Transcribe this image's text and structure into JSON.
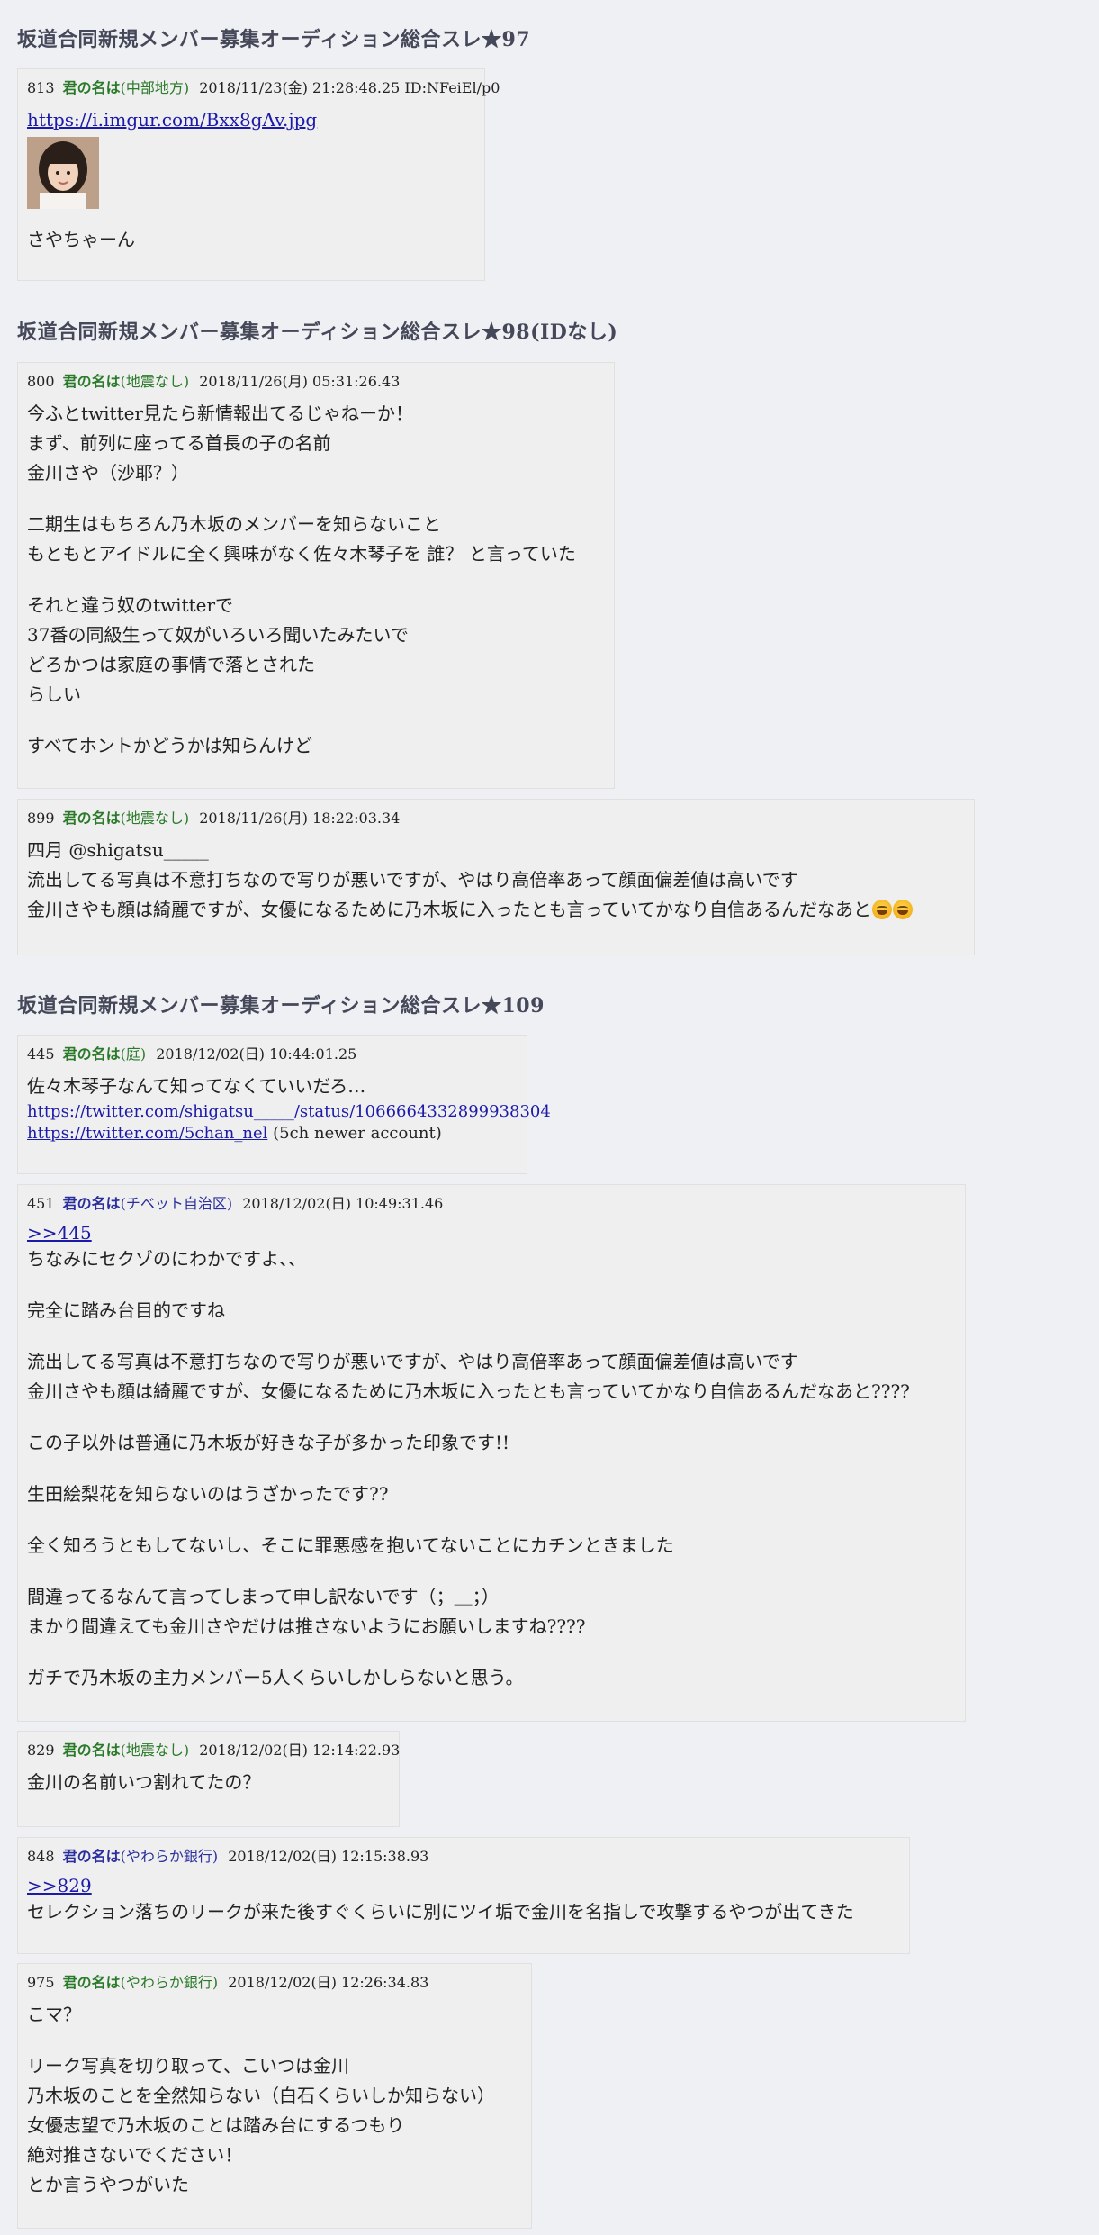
{
  "threads": [
    {
      "title": "坂道合同新規メンバー募集オーディション総合スレ★97",
      "posts": [
        {
          "num": "813",
          "name": "君の名は",
          "region": "(中部地方)",
          "date": "2018/11/23(金) 21:28:48.25 ID:NFeiEl/p0",
          "link": "https://i.imgur.com/Bxx8gAv.jpg",
          "text": "さやちゃーん"
        }
      ]
    },
    {
      "title": "坂道合同新規メンバー募集オーディション総合スレ★98(IDなし)",
      "posts": [
        {
          "num": "800",
          "name": "君の名は",
          "region": "(地震なし)",
          "date": "2018/11/26(月) 05:31:26.43",
          "lines": [
            "今ふとtwitter見たら新情報出てるじゃねーか！",
            "まず、前列に座ってる首長の子の名前",
            "金川さや（沙耶？）",
            "二期生はもちろん乃木坂のメンバーを知らないこと",
            "もともとアイドルに全く興味がなく佐々木琴子を 誰？ と言っていた",
            "それと違う奴のtwitterで",
            "37番の同級生って奴がいろいろ聞いたみたいで",
            "どろかつは家庭の事情で落とされた",
            "らしい",
            "すべてホントかどうかは知らんけど"
          ]
        },
        {
          "num": "899",
          "name": "君の名は",
          "region": "(地震なし)",
          "date": "2018/11/26(月) 18:22:03.34",
          "lines": [
            "四月 @shigatsu_____",
            "流出してる写真は不意打ちなので写りが悪いですが、やはり高倍率あって顔面偏差値は高いです",
            "金川さやも顔は綺麗ですが、女優になるために乃木坂に入ったとも言っていてかなり自信あるんだなあと"
          ]
        }
      ]
    },
    {
      "title": "坂道合同新規メンバー募集オーディション総合スレ★109",
      "posts": [
        {
          "num": "445",
          "name": "君の名は",
          "region": "(庭)",
          "date": "2018/12/02(日) 10:44:01.25",
          "text": "佐々木琴子なんて知ってなくていいだろ…",
          "link1": "https://twitter.com/shigatsu_____/status/1066664332899938304",
          "link2": "https://twitter.com/5chan_nel",
          "link2_note": " (5ch newer account)"
        },
        {
          "num": "451",
          "name": "君の名は",
          "region": "(チベット自治区)",
          "date": "2018/12/02(日) 10:49:31.46",
          "anchor": ">>445",
          "lines": [
            "ちなみにセクゾのにわかですよ、、",
            "完全に踏み台目的ですね",
            "流出してる写真は不意打ちなので写りが悪いですが、やはり高倍率あって顔面偏差値は高いです",
            "金川さやも顔は綺麗ですが、女優になるために乃木坂に入ったとも言っていてかなり自信あるんだなあと????",
            "この子以外は普通に乃木坂が好きな子が多かった印象です!!",
            "生田絵梨花を知らないのはうざかったです??",
            "全く知ろうともしてないし、そこに罪悪感を抱いてないことにカチンときました",
            "間違ってるなんて言ってしまって申し訳ないです（；＿；）",
            "まかり間違えても金川さやだけは推さないようにお願いしますね????",
            "ガチで乃木坂の主力メンバー5人くらいしかしらないと思う。"
          ]
        },
        {
          "num": "829",
          "name": "君の名は",
          "region": "(地震なし)",
          "date": "2018/12/02(日) 12:14:22.93",
          "text": "金川の名前いつ割れてたの？"
        },
        {
          "num": "848",
          "name": "君の名は",
          "region": "(やわらか銀行)",
          "date": "2018/12/02(日) 12:15:38.93",
          "anchor": ">>829",
          "text": "セレクション落ちのリークが来た後すぐくらいに別にツイ垢で金川を名指しで攻撃するやつが出てきた"
        },
        {
          "num": "975",
          "name": "君の名は",
          "region": "(やわらか銀行)",
          "date": "2018/12/02(日) 12:26:34.83",
          "lines": [
            "こマ？",
            "リーク写真を切り取って、こいつは金川",
            "乃木坂のことを全然知らない（白石くらいしか知らない）",
            "女優志望で乃木坂のことは踏み台にするつもり",
            "絶対推さないでください！",
            "とか言うやつがいた"
          ]
        }
      ]
    }
  ]
}
